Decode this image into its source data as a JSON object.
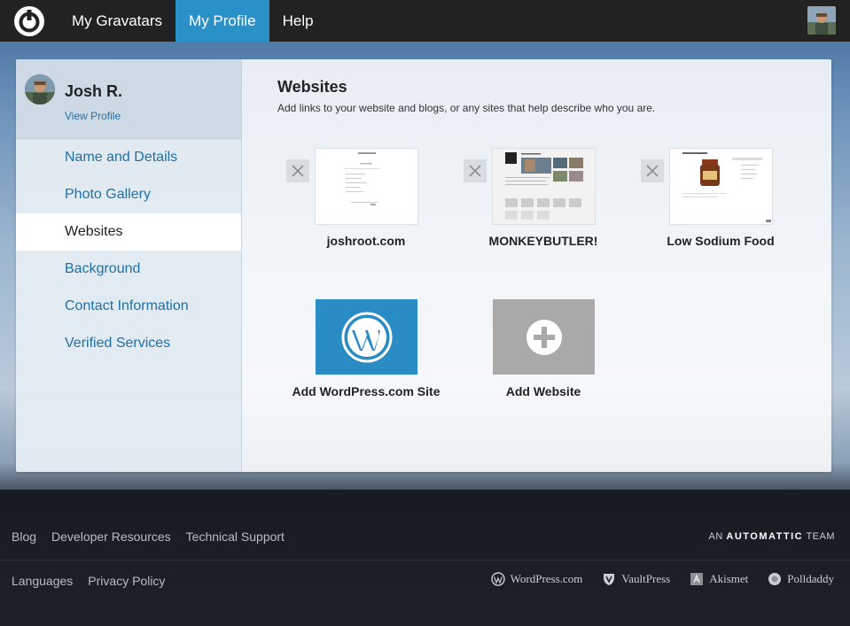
{
  "nav": {
    "items": [
      {
        "label": "My Gravatars"
      },
      {
        "label": "My Profile"
      },
      {
        "label": "Help"
      }
    ]
  },
  "profile": {
    "name": "Josh R.",
    "view_link": "View Profile"
  },
  "sidebar": {
    "items": [
      {
        "label": "Name and Details"
      },
      {
        "label": "Photo Gallery"
      },
      {
        "label": "Websites"
      },
      {
        "label": "Background"
      },
      {
        "label": "Contact Information"
      },
      {
        "label": "Verified Services"
      }
    ]
  },
  "main": {
    "title": "Websites",
    "description": "Add links to your website and blogs, or any sites that help describe who you are.",
    "sites": [
      {
        "label": "joshroot.com"
      },
      {
        "label": "MONKEYBUTLER!"
      },
      {
        "label": "Low Sodium Food"
      }
    ],
    "add_actions": [
      {
        "label": "Add WordPress.com Site"
      },
      {
        "label": "Add Website"
      }
    ]
  },
  "footer": {
    "links_row1": [
      "Blog",
      "Developer Resources",
      "Technical Support"
    ],
    "links_row2": [
      "Languages",
      "Privacy Policy"
    ],
    "team_prefix": "AN",
    "team_brand": "AUTOMATTIC",
    "team_suffix": "TEAM",
    "brands": [
      "WordPress.com",
      "VaultPress",
      "Akismet",
      "Polldaddy"
    ]
  },
  "colors": {
    "accent": "#2a90c8",
    "link": "#1f6fa8",
    "wordpress_tile": "#2a8cc4",
    "add_tile": "#a9a9a9"
  }
}
